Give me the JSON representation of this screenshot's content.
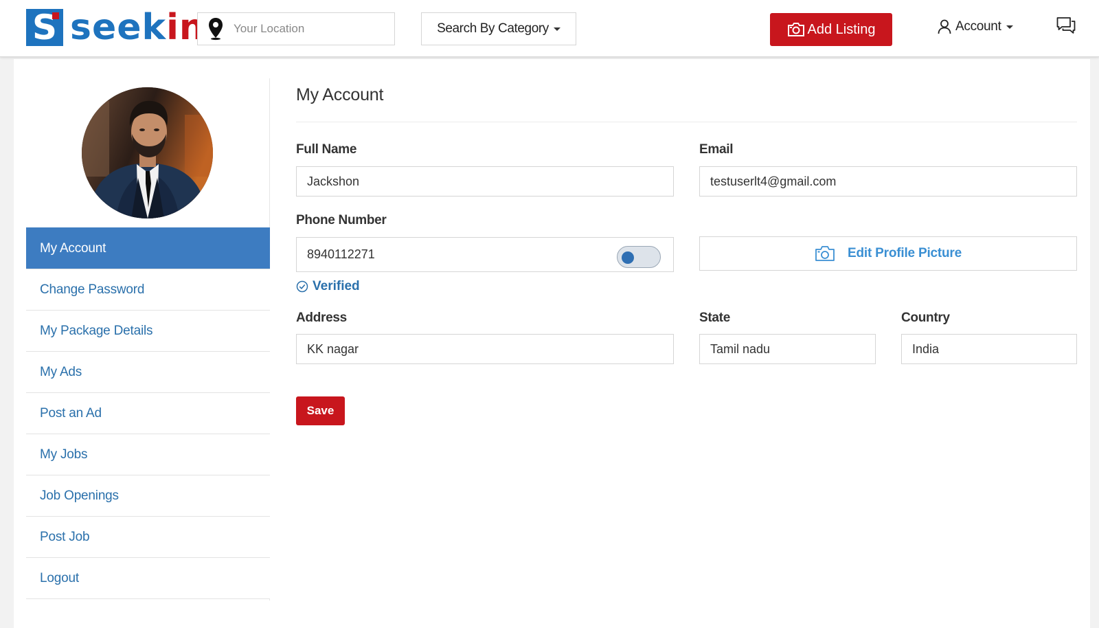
{
  "header": {
    "logo": {
      "prefix": "seek",
      "suffix": "in",
      "badge_letter": "S"
    },
    "location": {
      "placeholder": "Your Location",
      "value": ""
    },
    "category_label": "Search By Category",
    "add_listing_label": "Add Listing",
    "account_label": "Account"
  },
  "sidebar": {
    "items": [
      {
        "label": "My Account",
        "active": true
      },
      {
        "label": "Change Password"
      },
      {
        "label": "My Package Details"
      },
      {
        "label": "My Ads"
      },
      {
        "label": "Post an Ad"
      },
      {
        "label": "My Jobs"
      },
      {
        "label": "Job Openings"
      },
      {
        "label": "Post Job"
      },
      {
        "label": "Logout"
      }
    ]
  },
  "main": {
    "title": "My Account",
    "full_name": {
      "label": "Full Name",
      "value": "Jackshon"
    },
    "email": {
      "label": "Email",
      "value": "testuserlt4@gmail.com"
    },
    "phone": {
      "label": "Phone Number",
      "value": "8940112271",
      "verified_label": "Verified"
    },
    "edit_picture_label": "Edit Profile Picture",
    "address": {
      "label": "Address",
      "value": "KK nagar"
    },
    "state": {
      "label": "State",
      "value": "Tamil nadu"
    },
    "country": {
      "label": "Country",
      "value": "India"
    },
    "save_label": "Save"
  },
  "colors": {
    "brand_blue": "#1e73be",
    "brand_red": "#c8161d",
    "active_menu": "#3d7cc1",
    "link": "#2a70ab"
  },
  "icons": [
    "location-pin-icon",
    "caret-down-icon",
    "camera-icon",
    "user-icon",
    "chat-icon",
    "check-circle-icon"
  ]
}
